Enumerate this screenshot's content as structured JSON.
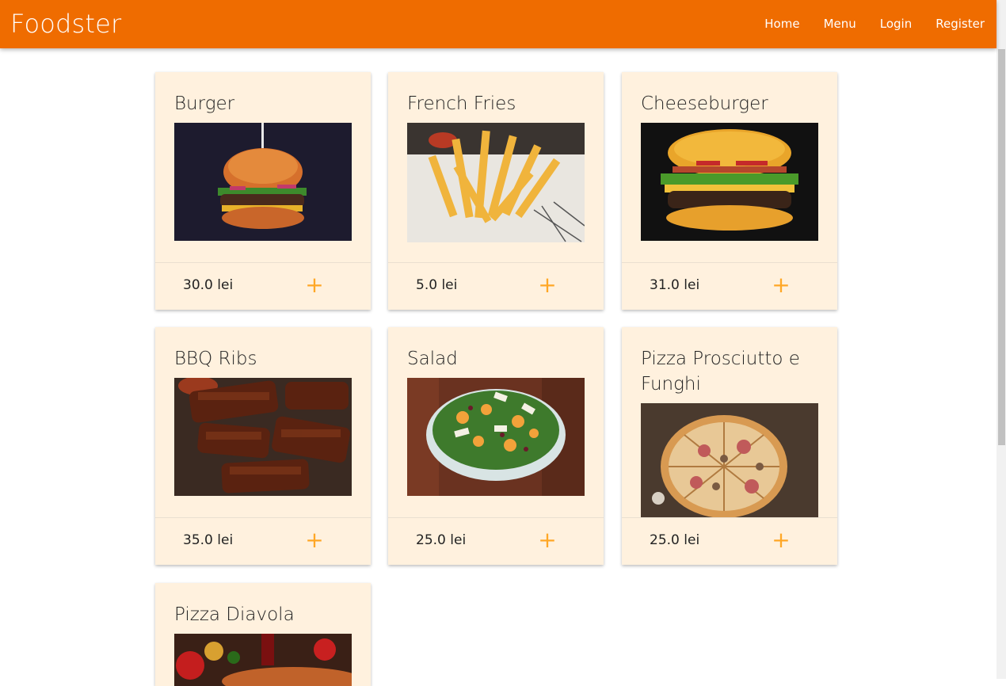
{
  "navbar": {
    "brand": "Foodster",
    "links": [
      "Home",
      "Menu",
      "Login",
      "Register"
    ],
    "background": "#ef6c00"
  },
  "accent_color": "#ffa726",
  "card_background": "#fff1de",
  "products": [
    {
      "name": "Burger",
      "price": "30.0 lei",
      "add_icon": "plus-icon"
    },
    {
      "name": "French Fries",
      "price": "5.0 lei",
      "add_icon": "plus-icon"
    },
    {
      "name": "Cheeseburger",
      "price": "31.0 lei",
      "add_icon": "plus-icon"
    },
    {
      "name": "BBQ Ribs",
      "price": "35.0 lei",
      "add_icon": "plus-icon"
    },
    {
      "name": "Salad",
      "price": "25.0 lei",
      "add_icon": "plus-icon"
    },
    {
      "name": "Pizza Prosciutto e Funghi",
      "price": "25.0 lei",
      "add_icon": "plus-icon"
    },
    {
      "name": "Pizza Diavola",
      "price": "",
      "add_icon": "plus-icon"
    }
  ]
}
